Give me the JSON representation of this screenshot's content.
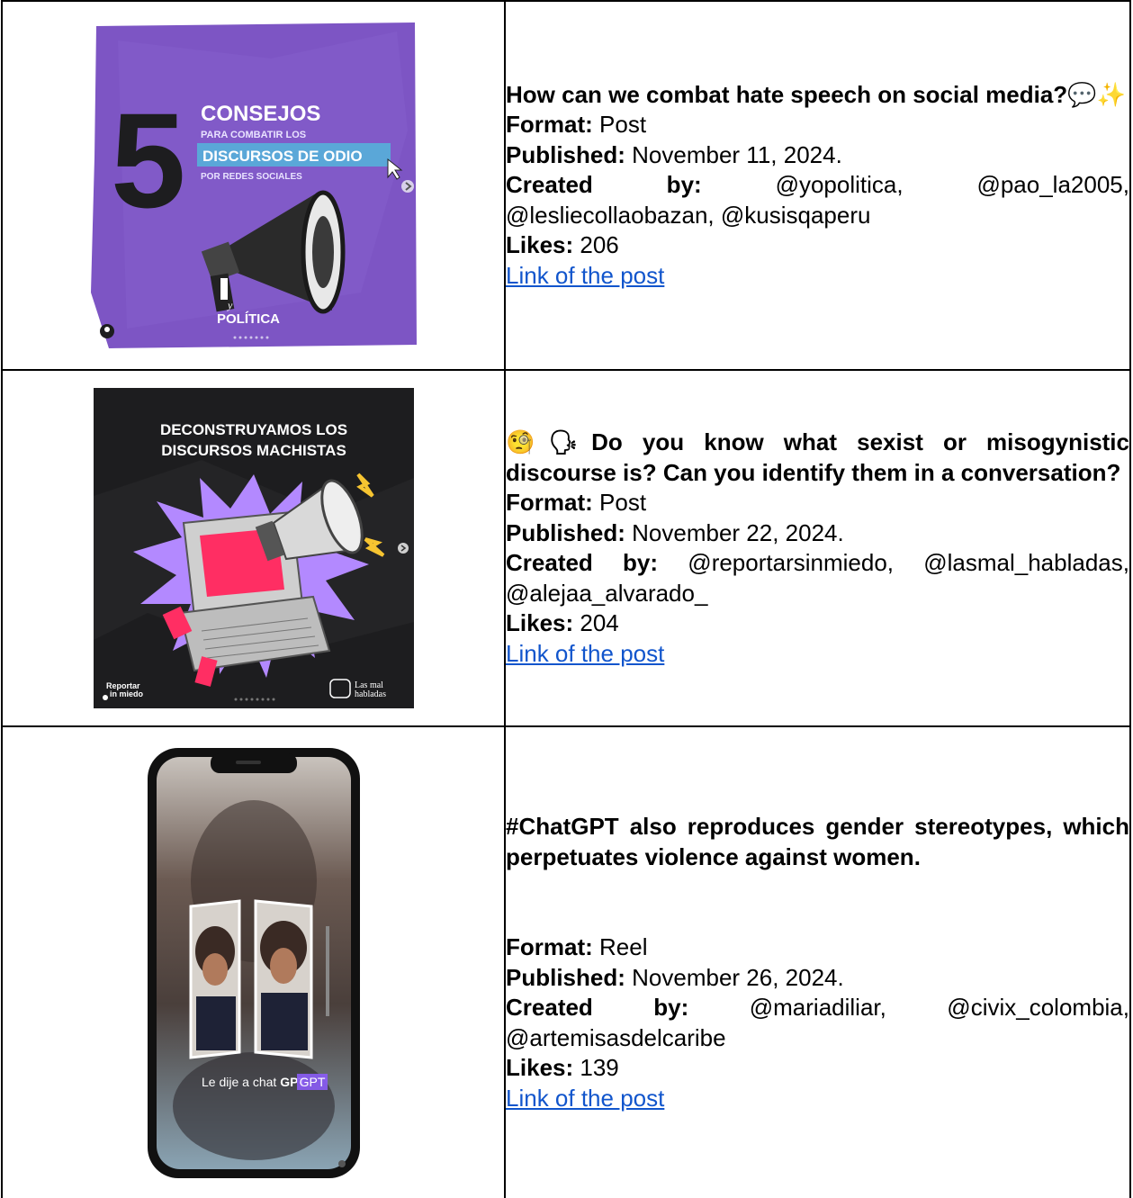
{
  "posts": [
    {
      "title": "How can we combat hate speech on social media?💬✨",
      "format_label": "Format:",
      "format": "Post",
      "published_label": "Published:",
      "published": "November 11, 2024.",
      "created_label": "Created by:",
      "created_by": "@yopolitica, @pao_la2005, @lesliecollaobazan, @kusisqaperu",
      "likes_label": "Likes:",
      "likes": "206",
      "link_text": "Link of the post",
      "image": {
        "line1": "CONSEJOS",
        "line2": "PARA COMBATIR LOS",
        "line3": "DISCURSOS DE ODIO",
        "line4": "POR REDES SOCIALES",
        "number": "5",
        "brand": "POLÍTICA",
        "brand_small": "y"
      }
    },
    {
      "title": "🧐🗣Do you know what sexist or misogynistic discourse is? Can you identify them in a conversation?",
      "format_label": "Format:",
      "format": "Post",
      "published_label": "Published:",
      "published": "November 22, 2024.",
      "created_label": "Created by:",
      "created_by": "@reportarsinmiedo, @lasmal_habladas, @alejaa_alvarado_",
      "likes_label": "Likes:",
      "likes": "204",
      "link_text": "Link of the post",
      "image": {
        "line1": "DECONSTRUYAMOS LOS",
        "line2": "DISCURSOS MACHISTAS",
        "brand_left_1": "Reportar",
        "brand_left_2": "in miedo",
        "brand_right_1": "Las mal",
        "brand_right_2": "habladas"
      }
    },
    {
      "title": "#ChatGPT also reproduces gender stereotypes, which perpetuates violence against women.",
      "format_label": "Format:",
      "format": "Reel",
      "published_label": "Published:",
      "published": "November 26, 2024.",
      "created_label": "Created by:",
      "created_by": "@mariadiliar, @civix_colombia, @artemisasdelcaribe",
      "likes_label": "Likes:",
      "likes": "139",
      "link_text": "Link of the post",
      "image": {
        "caption_a": "Le dije a chat ",
        "caption_b": "GPT"
      }
    }
  ],
  "colors": {
    "link": "#1155cc",
    "purple_bg": "#7d55c4",
    "dark_bg": "#1d1d1f",
    "accent_pink": "#ff2e63",
    "accent_violet": "#b389ff",
    "gpt_badge": "#8b5cf6"
  }
}
